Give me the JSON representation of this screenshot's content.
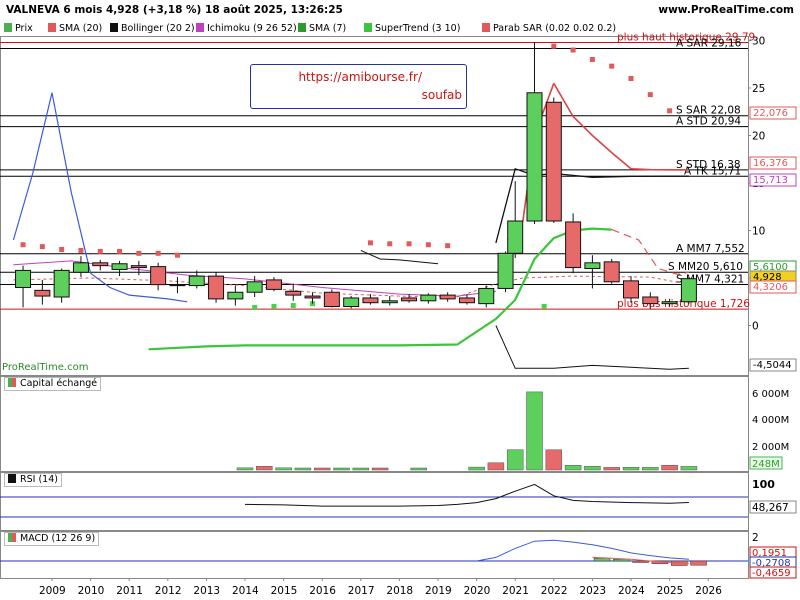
{
  "header": {
    "title": "VALNEVA 6 mois 4,928 (+3,18 %) 18 août 2025, 13:26:25",
    "site": "www.ProRealTime.com"
  },
  "legend": [
    {
      "label": "Prix",
      "color": "#4caf50"
    },
    {
      "label": "SMA (20)",
      "color": "#e05a5a"
    },
    {
      "label": "Bollinger (20 2)",
      "color": "#111111"
    },
    {
      "label": "Ichimoku (9 26 52)",
      "color": "#c040c0"
    },
    {
      "label": "SMA (7)",
      "color": "#2e9a2e"
    },
    {
      "label": "SuperTrend (3 10)",
      "color": "#3cc43c"
    },
    {
      "label": "Parab SAR (0.02 0.02 0.2)",
      "color": "#e05a5a"
    }
  ],
  "watermark": "ProRealTime.com",
  "annotation_box": {
    "url": "https://amibourse.fr/",
    "author": "soufab"
  },
  "price_panel": {
    "y_ticks": [
      "30",
      "25",
      "20",
      "15",
      "10",
      "5",
      "0"
    ],
    "right_labels": [
      {
        "text": "22,076",
        "color": "#e05a5a",
        "fill": "#ffffff"
      },
      {
        "text": "16,376",
        "color": "#e05a5a",
        "fill": "#ffffff"
      },
      {
        "text": "15,713",
        "color": "#c040c0",
        "fill": "#ffffff"
      },
      {
        "text": "5,6100",
        "color": "#2e9a2e",
        "fill": "#ffffff"
      },
      {
        "text": "4,928",
        "color": "#000000",
        "fill": "#f0d020"
      },
      {
        "text": "4,3206",
        "color": "#e05a5a",
        "fill": "#ffffff"
      },
      {
        "text": "-4,5044",
        "color": "#000000",
        "fill": "#ffffff"
      }
    ],
    "level_lines": [
      {
        "label": "plus haut historique 29,79",
        "value": 29.79,
        "color": "#d01010"
      },
      {
        "label": "A SAR 29,16",
        "value": 29.16,
        "color": "#000000"
      },
      {
        "label": "S SAR 22,08",
        "value": 22.08,
        "color": "#000000"
      },
      {
        "label": "A STD 20,94",
        "value": 20.94,
        "color": "#000000"
      },
      {
        "label": "S STD 16,38",
        "value": 16.38,
        "color": "#000000"
      },
      {
        "label": "A TK 15,71",
        "value": 15.71,
        "color": "#000000"
      },
      {
        "label": "A MM7 7,552",
        "value": 7.552,
        "color": "#000000"
      },
      {
        "label": "S MM20 5,610",
        "value": 5.61,
        "color": "#000000"
      },
      {
        "label": "S MM7 4,321",
        "value": 4.321,
        "color": "#000000"
      },
      {
        "label": "plus bas historique 1,726",
        "value": 1.726,
        "color": "#d01010"
      }
    ]
  },
  "volume_panel": {
    "title": "Capital échangé",
    "y_ticks": [
      "6 000M",
      "4 000M",
      "2 000M"
    ],
    "last_label": "248M"
  },
  "rsi_panel": {
    "title": "RSI (14)",
    "y_ticks": [
      "100"
    ],
    "last_label": "48,267"
  },
  "macd_panel": {
    "title": "MACD (12 26 9)",
    "y_ticks": [
      "2"
    ],
    "labels": [
      {
        "text": "0,1951",
        "color": "#d01010"
      },
      {
        "text": "-0,2708",
        "color": "#2233aa"
      },
      {
        "text": "-0,4659",
        "color": "#d01010"
      }
    ]
  },
  "x_axis": {
    "years": [
      "2009",
      "2010",
      "2011",
      "2012",
      "2013",
      "2014",
      "2015",
      "2016",
      "2017",
      "2018",
      "2019",
      "2020",
      "2021",
      "2022",
      "2023",
      "2024",
      "2025",
      "2026"
    ]
  },
  "chart_data": {
    "type": "candlestick",
    "period": "6 mois",
    "candles": [
      {
        "t": 2008.25,
        "open": 4.0,
        "high": 6.3,
        "low": 1.9,
        "close": 5.8
      },
      {
        "t": 2008.75,
        "open": 3.7,
        "high": 4.8,
        "low": 2.2,
        "close": 3.1
      },
      {
        "t": 2009.25,
        "open": 3.0,
        "high": 6.0,
        "low": 2.4,
        "close": 5.8
      },
      {
        "t": 2009.75,
        "open": 5.6,
        "high": 7.3,
        "low": 5.1,
        "close": 6.6
      },
      {
        "t": 2010.25,
        "open": 6.6,
        "high": 6.9,
        "low": 5.8,
        "close": 6.3
      },
      {
        "t": 2010.75,
        "open": 5.9,
        "high": 6.8,
        "low": 5.2,
        "close": 6.5
      },
      {
        "t": 2011.25,
        "open": 6.3,
        "high": 6.8,
        "low": 5.3,
        "close": 6.1
      },
      {
        "t": 2011.75,
        "open": 6.2,
        "high": 6.6,
        "low": 3.7,
        "close": 4.3
      },
      {
        "t": 2012.25,
        "open": 4.3,
        "high": 5.1,
        "low": 3.4,
        "close": 4.2
      },
      {
        "t": 2012.75,
        "open": 4.2,
        "high": 5.8,
        "low": 3.9,
        "close": 5.2
      },
      {
        "t": 2013.25,
        "open": 5.2,
        "high": 5.6,
        "low": 2.4,
        "close": 2.8
      },
      {
        "t": 2013.75,
        "open": 2.8,
        "high": 4.2,
        "low": 2.1,
        "close": 3.5
      },
      {
        "t": 2014.25,
        "open": 3.5,
        "high": 5.2,
        "low": 3.0,
        "close": 4.6
      },
      {
        "t": 2014.75,
        "open": 4.8,
        "high": 5.1,
        "low": 3.6,
        "close": 3.8
      },
      {
        "t": 2015.25,
        "open": 3.6,
        "high": 4.4,
        "low": 2.6,
        "close": 3.2
      },
      {
        "t": 2015.75,
        "open": 3.1,
        "high": 3.5,
        "low": 2.3,
        "close": 2.9
      },
      {
        "t": 2016.25,
        "open": 3.5,
        "high": 3.8,
        "low": 1.9,
        "close": 2.0
      },
      {
        "t": 2016.75,
        "open": 2.0,
        "high": 3.1,
        "low": 1.8,
        "close": 2.9
      },
      {
        "t": 2017.25,
        "open": 2.9,
        "high": 3.3,
        "low": 2.2,
        "close": 2.4
      },
      {
        "t": 2017.75,
        "open": 2.4,
        "high": 3.1,
        "low": 2.1,
        "close": 2.6
      },
      {
        "t": 2018.25,
        "open": 2.9,
        "high": 3.3,
        "low": 2.4,
        "close": 2.6
      },
      {
        "t": 2018.75,
        "open": 2.6,
        "high": 3.4,
        "low": 2.3,
        "close": 3.2
      },
      {
        "t": 2019.25,
        "open": 3.2,
        "high": 3.5,
        "low": 2.5,
        "close": 2.8
      },
      {
        "t": 2019.75,
        "open": 2.9,
        "high": 3.3,
        "low": 2.2,
        "close": 2.4
      },
      {
        "t": 2020.25,
        "open": 2.3,
        "high": 4.2,
        "low": 1.9,
        "close": 3.9
      },
      {
        "t": 2020.75,
        "open": 3.9,
        "high": 7.8,
        "low": 3.5,
        "close": 7.6
      },
      {
        "t": 2021.0,
        "open": 7.6,
        "high": 15.2,
        "low": 7.1,
        "close": 11.0
      },
      {
        "t": 2021.5,
        "open": 11.0,
        "high": 29.79,
        "low": 10.7,
        "close": 24.5
      },
      {
        "t": 2022.0,
        "open": 23.5,
        "high": 24.0,
        "low": 10.8,
        "close": 11.0
      },
      {
        "t": 2022.5,
        "open": 10.9,
        "high": 11.8,
        "low": 5.5,
        "close": 6.1
      },
      {
        "t": 2023.0,
        "open": 6.0,
        "high": 7.4,
        "low": 3.9,
        "close": 6.6
      },
      {
        "t": 2023.5,
        "open": 6.7,
        "high": 7.0,
        "low": 4.4,
        "close": 4.6
      },
      {
        "t": 2024.0,
        "open": 4.7,
        "high": 5.2,
        "low": 2.4,
        "close": 2.9
      },
      {
        "t": 2024.5,
        "open": 3.0,
        "high": 3.5,
        "low": 1.726,
        "close": 2.3
      },
      {
        "t": 2025.0,
        "open": 2.3,
        "high": 2.8,
        "low": 2.0,
        "close": 2.5
      },
      {
        "t": 2025.5,
        "open": 2.5,
        "high": 5.1,
        "low": 2.3,
        "close": 4.928
      }
    ],
    "volume": [
      {
        "t": 2014.0,
        "v": 150
      },
      {
        "t": 2014.5,
        "v": 260
      },
      {
        "t": 2015.0,
        "v": 150
      },
      {
        "t": 2015.5,
        "v": 120
      },
      {
        "t": 2016.0,
        "v": 80
      },
      {
        "t": 2016.5,
        "v": 80
      },
      {
        "t": 2017.0,
        "v": 60
      },
      {
        "t": 2017.5,
        "v": 60
      },
      {
        "t": 2018.5,
        "v": 60
      },
      {
        "t": 2020.0,
        "v": 200
      },
      {
        "t": 2020.5,
        "v": 500
      },
      {
        "t": 2021.0,
        "v": 1400
      },
      {
        "t": 2021.5,
        "v": 5400
      },
      {
        "t": 2022.0,
        "v": 1400
      },
      {
        "t": 2022.5,
        "v": 330
      },
      {
        "t": 2023.0,
        "v": 260
      },
      {
        "t": 2023.5,
        "v": 180
      },
      {
        "t": 2024.0,
        "v": 190
      },
      {
        "t": 2024.5,
        "v": 180
      },
      {
        "t": 2025.0,
        "v": 330
      },
      {
        "t": 2025.5,
        "v": 248
      }
    ],
    "sar_points": [
      [
        2008.25,
        8.5
      ],
      [
        2008.75,
        8.3
      ],
      [
        2009.25,
        8.0
      ],
      [
        2009.75,
        7.9
      ],
      [
        2010.25,
        7.8
      ],
      [
        2010.75,
        7.8
      ],
      [
        2011.25,
        7.6
      ],
      [
        2011.75,
        7.6
      ],
      [
        2012.25,
        7.4
      ],
      [
        2014.25,
        1.9
      ],
      [
        2014.75,
        2.0
      ],
      [
        2015.25,
        2.1
      ],
      [
        2015.75,
        2.3
      ],
      [
        2017.25,
        8.7
      ],
      [
        2017.75,
        8.6
      ],
      [
        2018.25,
        8.6
      ],
      [
        2018.75,
        8.5
      ],
      [
        2019.25,
        8.4
      ],
      [
        2021.75,
        2.0
      ],
      [
        2022.0,
        29.4
      ],
      [
        2022.5,
        29.0
      ],
      [
        2023.0,
        28.0
      ],
      [
        2023.5,
        27.3
      ],
      [
        2024.0,
        26.0
      ],
      [
        2024.5,
        24.3
      ],
      [
        2025.0,
        22.6
      ]
    ],
    "supertrend": [
      [
        2011.5,
        -2.5
      ],
      [
        2012.0,
        -2.4
      ],
      [
        2013.0,
        -2.2
      ],
      [
        2014.0,
        -2.1
      ],
      [
        2015.0,
        -2.1
      ],
      [
        2016.0,
        -2.1
      ],
      [
        2018.0,
        -2.1
      ],
      [
        2019.5,
        -2.0
      ],
      [
        2020.5,
        0.7
      ],
      [
        2021.0,
        2.7
      ],
      [
        2021.5,
        7.0
      ],
      [
        2022.0,
        9.2
      ],
      [
        2022.5,
        10.0
      ],
      [
        2023.0,
        10.2
      ],
      [
        2023.5,
        10.1
      ]
    ],
    "supertrend_dashed": [
      [
        2023.5,
        10.1
      ],
      [
        2024.2,
        9.0
      ],
      [
        2024.7,
        6.0
      ],
      [
        2025.2,
        5.4
      ],
      [
        2025.5,
        5.6
      ]
    ],
    "sma20": [
      [
        2020.5,
        8.7
      ],
      [
        2021.0,
        16.5
      ],
      [
        2021.5,
        15.8
      ],
      [
        2022.0,
        16.0
      ],
      [
        2022.5,
        15.8
      ],
      [
        2023.0,
        15.6
      ],
      [
        2024.0,
        15.7
      ],
      [
        2025.5,
        15.713
      ]
    ],
    "upper_dashed": [
      [
        2020.8,
        9.0
      ],
      [
        2021.2,
        11.0
      ],
      [
        2021.5,
        20.0
      ],
      [
        2022.0,
        25.5
      ],
      [
        2022.5,
        22.0
      ],
      [
        2023.0,
        20.0
      ],
      [
        2023.5,
        18.2
      ],
      [
        2024.0,
        16.5
      ],
      [
        2024.5,
        16.4
      ],
      [
        2025.5,
        16.376
      ]
    ],
    "lower_dashed_red": [
      [
        2008.0,
        4.8
      ],
      [
        2010.0,
        5.0
      ],
      [
        2012.0,
        4.7
      ],
      [
        2014.0,
        4.2
      ],
      [
        2016.0,
        3.4
      ],
      [
        2018.0,
        3.1
      ],
      [
        2019.5,
        3.0
      ],
      [
        2020.5,
        4.4
      ],
      [
        2021.2,
        5.0
      ],
      [
        2022.5,
        5.2
      ],
      [
        2024.5,
        5.1
      ],
      [
        2025.5,
        4.3206
      ]
    ],
    "magenta_line": [
      [
        2008.0,
        6.4
      ],
      [
        2009.5,
        6.8
      ],
      [
        2011.0,
        6.0
      ],
      [
        2012.5,
        5.3
      ],
      [
        2014.0,
        4.9
      ],
      [
        2016.0,
        4.0
      ],
      [
        2018.0,
        3.3
      ],
      [
        2019.5,
        3.1
      ],
      [
        2020.5,
        3.6
      ]
    ],
    "bollinger_lower": [
      [
        2020.5,
        0.0
      ],
      [
        2021.0,
        -4.5
      ],
      [
        2021.5,
        -4.5
      ],
      [
        2022.0,
        -4.5
      ],
      [
        2023.0,
        -4.2
      ],
      [
        2024.0,
        -4.4
      ],
      [
        2025.0,
        -4.6
      ],
      [
        2025.5,
        -4.5044
      ]
    ],
    "bollinger_upper_segment": [
      [
        2017.0,
        7.9
      ],
      [
        2017.5,
        7.0
      ],
      [
        2018.0,
        6.9
      ],
      [
        2019.0,
        6.5
      ]
    ],
    "blue_line": [
      [
        2008.0,
        9.0
      ],
      [
        2008.5,
        16.0
      ],
      [
        2009.0,
        24.5
      ],
      [
        2009.5,
        14.0
      ],
      [
        2010.0,
        5.5
      ],
      [
        2010.5,
        4.0
      ],
      [
        2011.0,
        3.2
      ],
      [
        2011.5,
        3.0
      ],
      [
        2012.0,
        2.8
      ],
      [
        2012.5,
        2.5
      ]
    ],
    "rsi": [
      [
        2014.0,
        45
      ],
      [
        2015.0,
        44
      ],
      [
        2016.0,
        42
      ],
      [
        2017.0,
        42
      ],
      [
        2018.0,
        42
      ],
      [
        2019.0,
        43
      ],
      [
        2019.5,
        45
      ],
      [
        2020.0,
        48
      ],
      [
        2020.5,
        55
      ],
      [
        2021.0,
        68
      ],
      [
        2021.5,
        80
      ],
      [
        2022.0,
        60
      ],
      [
        2022.5,
        52
      ],
      [
        2023.0,
        50
      ],
      [
        2024.0,
        48
      ],
      [
        2025.0,
        47
      ],
      [
        2025.5,
        48.267
      ]
    ],
    "macd_line": [
      [
        2020.0,
        0.0
      ],
      [
        2020.5,
        0.4
      ],
      [
        2021.0,
        1.4
      ],
      [
        2021.5,
        2.2
      ],
      [
        2022.0,
        2.3
      ],
      [
        2022.5,
        2.1
      ],
      [
        2023.0,
        1.8
      ],
      [
        2023.5,
        1.4
      ],
      [
        2024.0,
        0.9
      ],
      [
        2024.5,
        0.6
      ],
      [
        2025.0,
        0.35
      ],
      [
        2025.5,
        0.1951
      ]
    ],
    "macd_signal": [
      [
        2023.0,
        0.4
      ],
      [
        2023.5,
        0.3
      ],
      [
        2024.0,
        0.2
      ],
      [
        2024.5,
        0.0
      ],
      [
        2025.0,
        -0.15
      ],
      [
        2025.5,
        -0.2708
      ]
    ],
    "macd_hist": [
      [
        2023.25,
        0.3
      ],
      [
        2023.75,
        0.2
      ],
      [
        2024.25,
        -0.15
      ],
      [
        2024.75,
        -0.3
      ],
      [
        2025.25,
        -0.5
      ],
      [
        2025.75,
        -0.4659
      ]
    ]
  }
}
